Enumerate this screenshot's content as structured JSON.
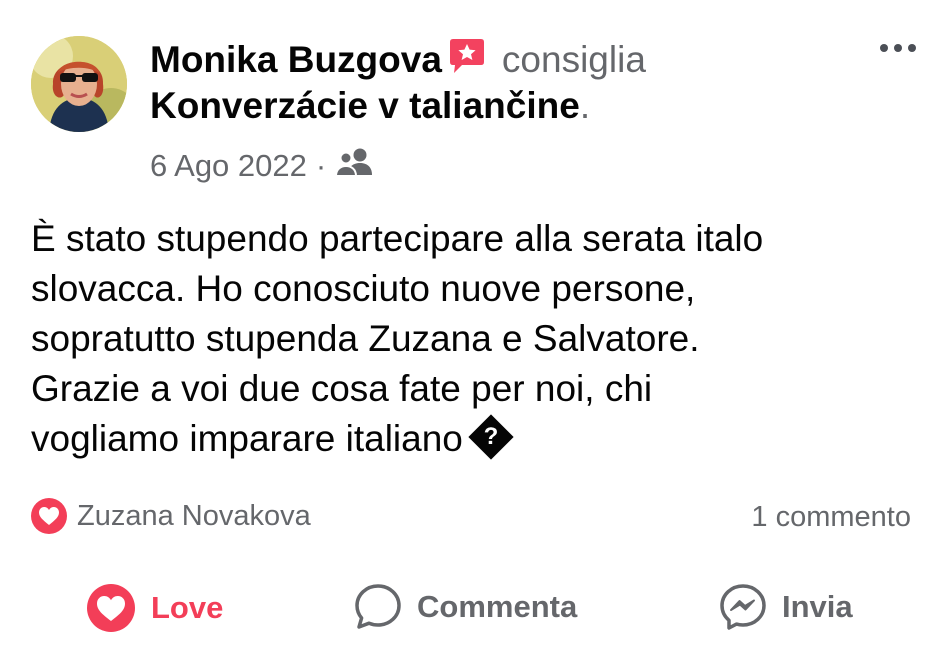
{
  "post": {
    "author": "Monika Buzgova",
    "recommends": "consiglia",
    "page_name": "Konverzácie v taliančine",
    "page_name_suffix": ".",
    "date": "6 Ago 2022",
    "date_separator": "·",
    "audience_icon": "friends-icon",
    "text_lines": [
      "È stato stupendo partecipare alla serata italo",
      "slovacca. Ho conosciuto nuove persone,",
      "sopratutto stupenda Zuzana e Salvatore.",
      "Grazie a voi due cosa fate per noi, chi",
      "vogliamo imparare italiano"
    ],
    "unknown_glyph": "?"
  },
  "reactions": {
    "icon": "heart-icon",
    "names": "Zuzana Novakova",
    "comments": "1 commento"
  },
  "actions": {
    "love": "Love",
    "comment": "Commenta",
    "share": "Invia"
  },
  "colors": {
    "love": "#f33e58",
    "secondary_text": "#65676b",
    "recommend_badge": "#f3425f"
  }
}
